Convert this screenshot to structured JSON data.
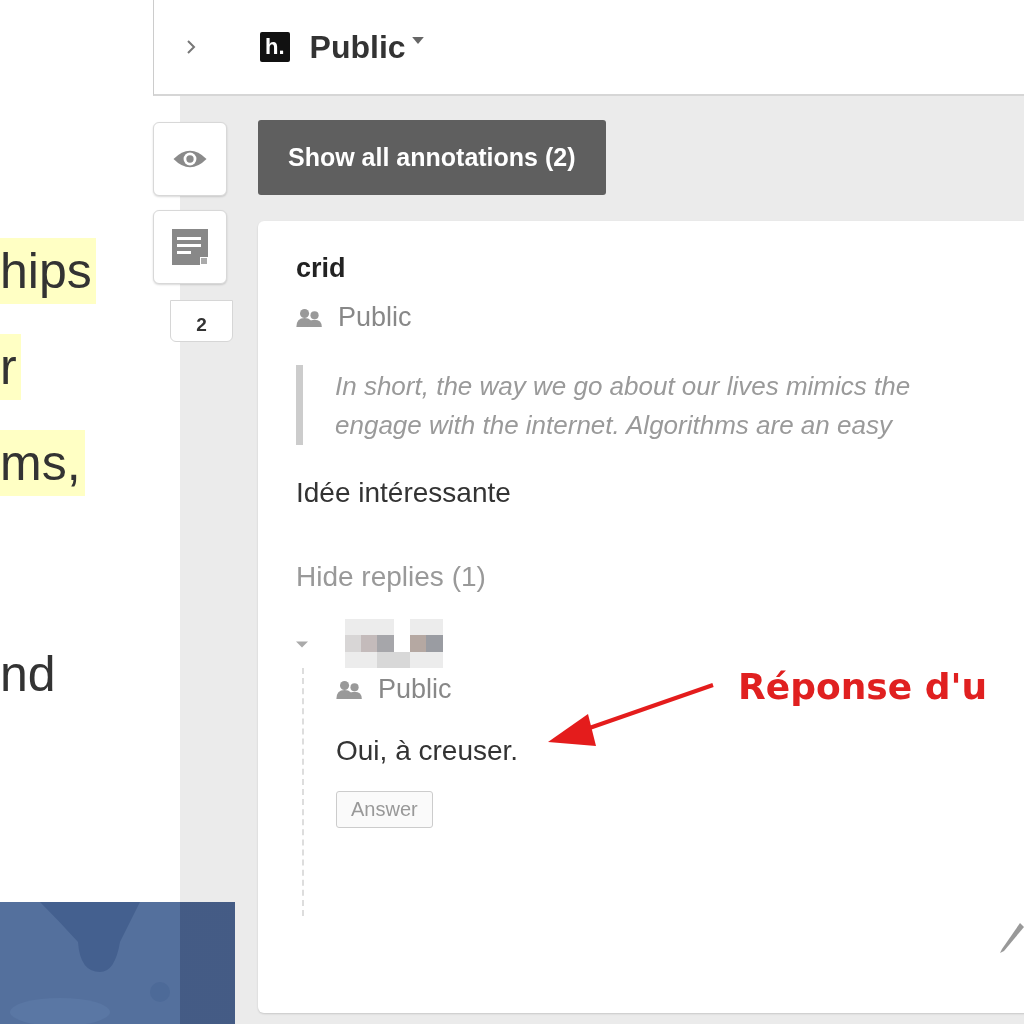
{
  "page_text": {
    "paragraphs": [
      {
        "lines": [
          {
            "text": "hips",
            "highlighted": true
          },
          {
            "text": "r",
            "highlighted": true
          },
          {
            "text": "ms,",
            "highlighted": true
          }
        ]
      },
      {
        "lines": [
          {
            "text": "nd",
            "highlighted": false
          }
        ]
      }
    ]
  },
  "sidebar": {
    "top_bar": {
      "logo": "h.",
      "group": "Public"
    },
    "tools": [
      {
        "kind": "eye"
      },
      {
        "kind": "note"
      }
    ],
    "annotation_count": "2",
    "show_all_button": "Show all annotations (2)",
    "annotation": {
      "author": "crid",
      "visibility": "Public",
      "quote": [
        "In short, the way we go about our lives mimics the",
        "engage with the internet. Algorithms are an easy"
      ],
      "body": "Idée intéressante",
      "replies_toggle": "Hide replies (1)",
      "replies": [
        {
          "expanded": true,
          "visibility": "Public",
          "body": "Oui, à creuser.",
          "answer_button": "Answer"
        }
      ]
    }
  },
  "callout": {
    "text": "Réponse d'u"
  }
}
